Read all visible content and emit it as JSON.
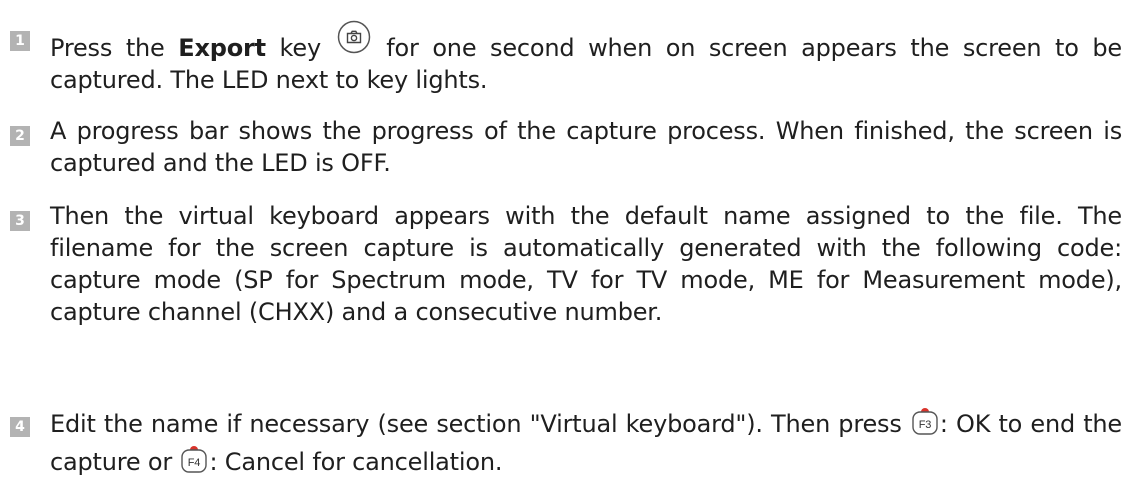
{
  "steps": [
    {
      "number": "1",
      "pre": "Press the ",
      "bold": "Export",
      "mid": " key ",
      "icon": "camera-key-icon",
      "post": " for one second when on screen appears the screen to be captured. The LED next to key lights."
    },
    {
      "number": "2",
      "text": "A progress bar shows the progress of the capture process. When finished, the screen is captured and the LED is OFF."
    },
    {
      "number": "3",
      "text": "Then the virtual keyboard appears with the default name assigned to the file. The filename for the screen capture is automatically generated with the following code: capture mode (SP for Spectrum mode, TV for TV mode, ME for Measurement mode), capture channel (CHXX) and a consecutive number."
    },
    {
      "number": "4",
      "pre": "Edit the name if necessary (see section \"Virtual keyboard\"). Then press ",
      "key1": "F3",
      "mid": ": OK to end the capture or ",
      "key2": "F4",
      "post": ": Cancel for cancellation."
    }
  ]
}
